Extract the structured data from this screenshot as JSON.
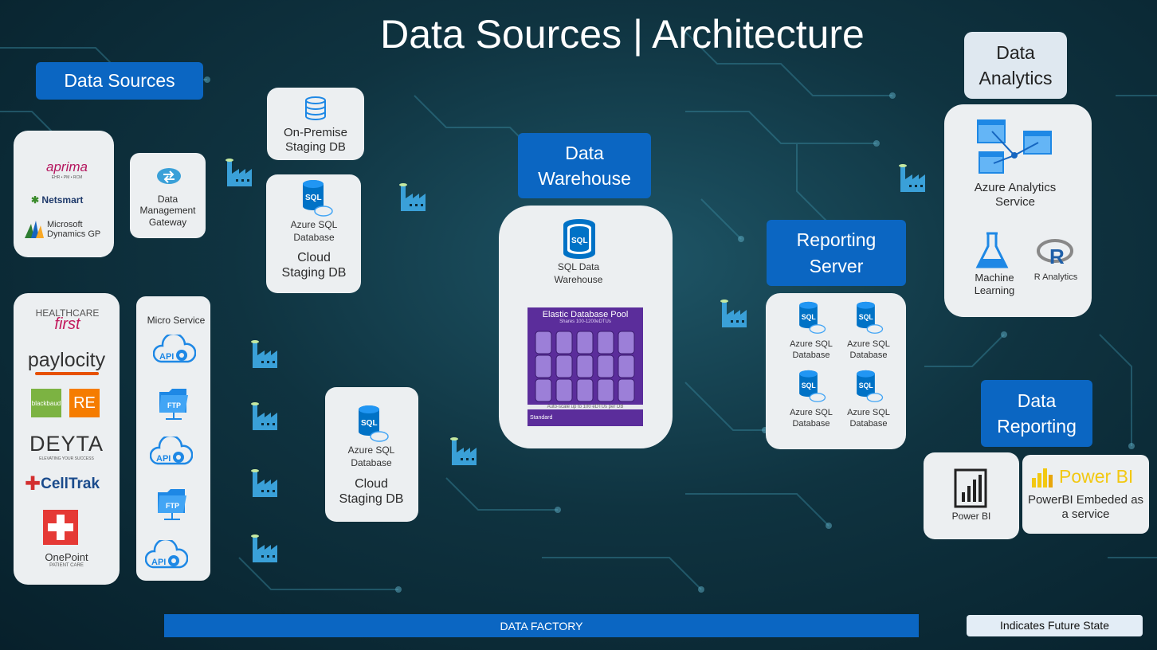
{
  "title": "Data Sources | Architecture",
  "data_sources": {
    "label": "Data Sources",
    "group1": [
      "aprima",
      "Netsmart",
      "Microsoft Dynamics GP"
    ],
    "aprima_sub": "EHR • PM • RCM",
    "group2": [
      "HEALTHCARE",
      "first",
      "paylocity",
      "blackbaud",
      "RE",
      "DEYTA",
      "ELEVATING YOUR SUCCESS",
      "CellTrak",
      "OnePoint",
      "PATIENT CARE"
    ]
  },
  "gateway": {
    "label": "Data Management Gateway"
  },
  "micro_service": {
    "label": "Micro Service",
    "items": [
      "API",
      "FTP",
      "API",
      "FTP",
      "API"
    ]
  },
  "onprem_staging": {
    "label": "On-Premise Staging DB"
  },
  "cloud_staging_1": {
    "db": "Azure SQL Database",
    "label": "Cloud Staging DB"
  },
  "cloud_staging_2": {
    "db": "Azure SQL Database",
    "label": "Cloud Staging DB"
  },
  "warehouse": {
    "header": "Data Warehouse",
    "db": "SQL Data Warehouse",
    "pool_title": "Elastic Database Pool",
    "pool_sub": "Shares 100-1200eDTUs",
    "pool_note": "Auto-scale up to 100 eDTUs per DB",
    "pool_tier": "Standard"
  },
  "reporting_server": {
    "header": "Reporting Server",
    "dbs": [
      "Azure SQL Database",
      "Azure SQL Database",
      "Azure SQL Database",
      "Azure SQL Database"
    ]
  },
  "analytics": {
    "header": "Data Analytics",
    "service": "Azure Analytics Service",
    "ml": "Machine Learning",
    "r": "R Analytics"
  },
  "reporting": {
    "header": "Data Reporting",
    "powerbi": "Power BI",
    "embedded_brand": "Power BI",
    "embedded": "PowerBI Embeded as a service"
  },
  "data_factory": "DATA FACTORY",
  "legend": "Indicates Future State",
  "colors": {
    "accent": "#0b66c2",
    "card": "#eceff1",
    "sql": "#0072c6",
    "factory": "#3aa0d8"
  }
}
